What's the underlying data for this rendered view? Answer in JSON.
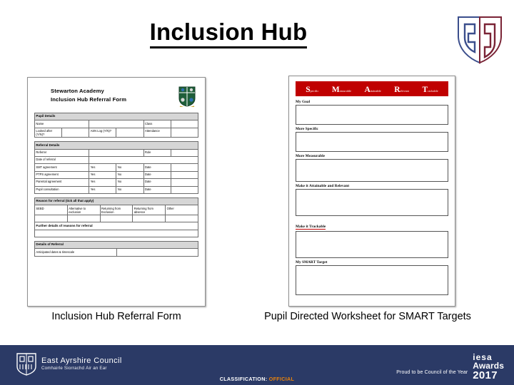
{
  "slide": {
    "title": "Inclusion Hub"
  },
  "brand": {
    "shield_icon": "pd-shield-icon",
    "shield_left_color": "#3b4e8c",
    "shield_right_color": "#7a2436"
  },
  "referral_doc": {
    "school": "Stewarton Academy",
    "form_title": "Inclusion Hub Referral Form",
    "crest_icon": "stewarton-academy-crest",
    "sections": [
      {
        "heading": "Pupil Details",
        "rows": [
          [
            "Name",
            "",
            "Class",
            ""
          ],
          [
            "Looked after (Y/N)?",
            "",
            "ASN Log (Y/N)?",
            "",
            "Attendance",
            ""
          ]
        ]
      },
      {
        "heading": "Referral Details",
        "rows": [
          [
            "Referrer",
            "",
            "Role",
            ""
          ],
          [
            "Date of referral",
            ""
          ],
          [
            "SMT agreement",
            "Yes",
            "",
            "No",
            "Date",
            ""
          ],
          [
            "PTPS agreement",
            "Yes",
            "",
            "No",
            "Date",
            ""
          ],
          [
            "Parental agreement",
            "Yes",
            "",
            "No",
            "Date",
            ""
          ],
          [
            "Pupil consultation",
            "Yes",
            "",
            "No",
            "Date",
            ""
          ]
        ]
      },
      {
        "heading": "Reason for referral (tick all that apply)",
        "columns": [
          "SEBD",
          "Alternative to exclusion",
          "Returning from Exclusion",
          "Returning from absence",
          "Other"
        ],
        "subheading": "Further details of reasons for referral"
      },
      {
        "heading": "Details of Referral",
        "rows": [
          [
            "Anticipated dates & timescale",
            ""
          ]
        ]
      }
    ]
  },
  "smart_doc": {
    "banner_color": "#c00000",
    "acronym": [
      {
        "letter": "S",
        "rest": "pecific"
      },
      {
        "letter": "M",
        "rest": "easurable"
      },
      {
        "letter": "A",
        "rest": "ttainable"
      },
      {
        "letter": "R",
        "rest": "elevant"
      },
      {
        "letter": "T",
        "rest": "rackable"
      }
    ],
    "fields": [
      {
        "label": "My Goal",
        "underline": false
      },
      {
        "label": "More Specific",
        "underline": false
      },
      {
        "label": "More Measurable",
        "underline": false
      },
      {
        "label": "Make it Attainable and Relevant",
        "underline": false
      },
      {
        "label": "Make it Trackable",
        "underline": true
      },
      {
        "label": "My SMART Target",
        "underline": false
      }
    ]
  },
  "captions": {
    "left": "Inclusion Hub Referral Form",
    "right": "Pupil Directed Worksheet for SMART Targets"
  },
  "footer": {
    "background": "#2b3a66",
    "council_name": "East Ayrshire Council",
    "council_gaelic": "Comhairle Siorrachd Àir an Ear",
    "council_shield_icon": "east-ayrshire-shield-icon",
    "award_tagline": "Proud to be Council of the Year",
    "award_brand": "iesa",
    "award_word": "Awards",
    "award_year": "2017",
    "classification_label": "CLASSIFICATION:",
    "classification_value": "OFFICIAL",
    "classification_color": "#e8820c"
  }
}
